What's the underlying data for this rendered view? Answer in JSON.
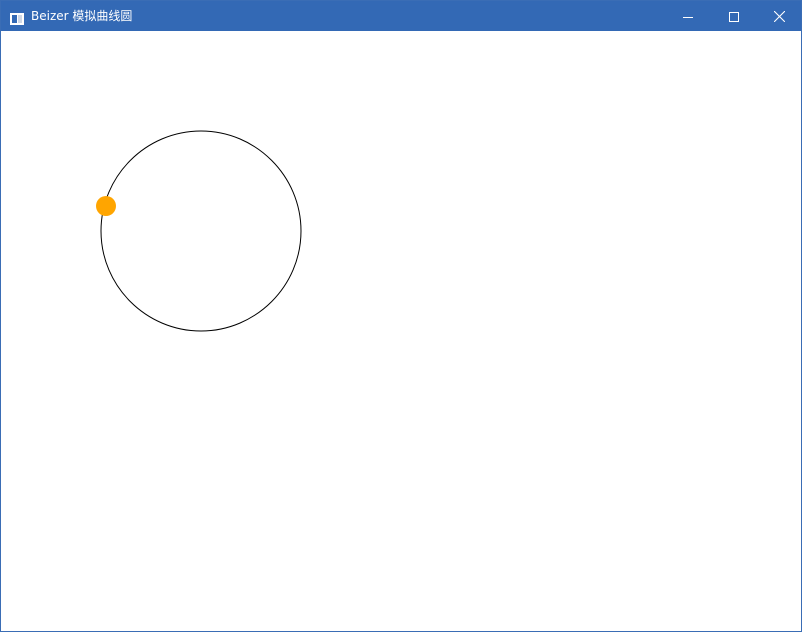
{
  "window": {
    "title": "Beizer 模拟曲线圆",
    "app_icon": "window-app-icon",
    "buttons": {
      "minimize": "minimize-icon",
      "maximize": "maximize-icon",
      "close": "close-icon"
    }
  },
  "canvas": {
    "curve_color": "#000000",
    "marker_color": "#ffa500",
    "titlebar_color": "#3369b5",
    "background_color": "#ffffff"
  }
}
